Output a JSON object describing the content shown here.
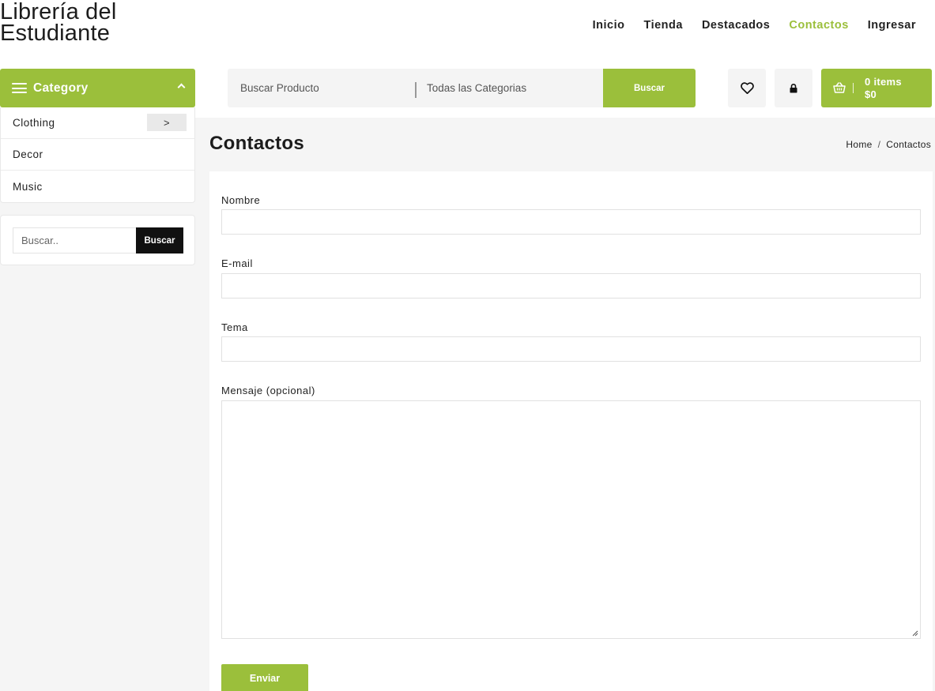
{
  "brand": {
    "line1": "Librería del",
    "line2": "Estudiante"
  },
  "nav": {
    "items": [
      "Inicio",
      "Tienda",
      "Destacados",
      "Contactos",
      "Ingresar"
    ],
    "active": "Contactos"
  },
  "category": {
    "title": "Category",
    "items": [
      {
        "label": "Clothing",
        "has_submenu": true,
        "submenu_glyph": ">"
      },
      {
        "label": "Decor"
      },
      {
        "label": "Music"
      }
    ]
  },
  "sidebar_search": {
    "placeholder": "Buscar..",
    "button": "Buscar"
  },
  "search": {
    "product_placeholder": "Buscar Producto",
    "category_label": "Todas las Categorias",
    "button": "Buscar"
  },
  "icons": {
    "wishlist": "heart-icon",
    "account": "lock-icon",
    "cart": "basket-icon"
  },
  "cart": {
    "items": "0 items",
    "total": "$0"
  },
  "page": {
    "title": "Contactos",
    "breadcrumb": [
      "Home",
      "Contactos"
    ],
    "breadcrumb_separator": "/"
  },
  "form": {
    "name_label": "Nombre",
    "email_label": "E-mail",
    "subject_label": "Tema",
    "message_label": "Mensaje (opcional)",
    "submit": "Enviar"
  },
  "colors": {
    "accent": "#9bbf3b",
    "dark": "#111111",
    "background": "#f5f5f5"
  }
}
